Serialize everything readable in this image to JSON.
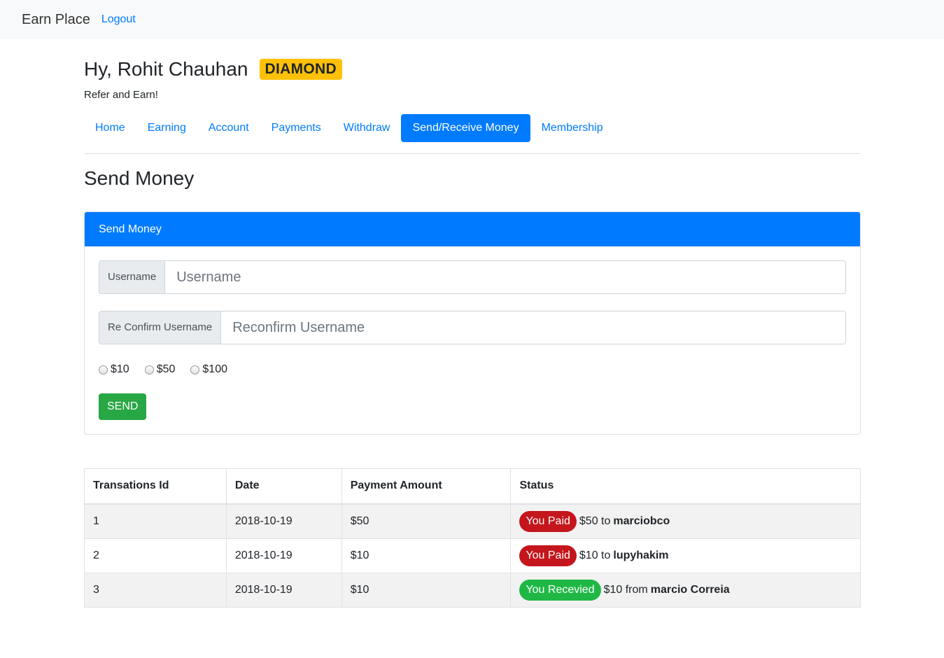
{
  "navbar": {
    "brand": "Earn Place",
    "logout": "Logout"
  },
  "user": {
    "greeting": "Hy, Rohit Chauhan",
    "level": "DIAMOND",
    "subtitle": "Refer and Earn!"
  },
  "tabs": [
    {
      "label": "Home",
      "active": false
    },
    {
      "label": "Earning",
      "active": false
    },
    {
      "label": "Account",
      "active": false
    },
    {
      "label": "Payments",
      "active": false
    },
    {
      "label": "Withdraw",
      "active": false
    },
    {
      "label": "Send/Receive Money",
      "active": true
    },
    {
      "label": "Membership",
      "active": false
    }
  ],
  "section_title": "Send Money",
  "form": {
    "header": "Send Money",
    "username": {
      "label": "Username",
      "placeholder": "Username",
      "value": ""
    },
    "confirm": {
      "label": "Re Confirm Username",
      "placeholder": "Reconfirm Username",
      "value": ""
    },
    "amounts": [
      "$10",
      "$50",
      "$100"
    ],
    "submit": "SEND"
  },
  "table": {
    "headers": [
      "Transations Id",
      "Date",
      "Payment Amount",
      "Status"
    ],
    "rows": [
      {
        "id": "1",
        "date": "2018-10-19",
        "amount": "$50",
        "status": "You Paid",
        "type": "paid",
        "detail": "$50 to",
        "party": "marciobco"
      },
      {
        "id": "2",
        "date": "2018-10-19",
        "amount": "$10",
        "status": "You Paid",
        "type": "paid",
        "detail": "$10 to",
        "party": "lupyhakim"
      },
      {
        "id": "3",
        "date": "2018-10-19",
        "amount": "$10",
        "status": "You Recevied",
        "type": "recv",
        "detail": "$10 from",
        "party": "marcio Correia"
      }
    ]
  },
  "colors": {
    "primary": "#007bff",
    "success": "#28a745",
    "warning": "#ffc107",
    "paid": "#c4161c",
    "received": "#1fb845"
  }
}
